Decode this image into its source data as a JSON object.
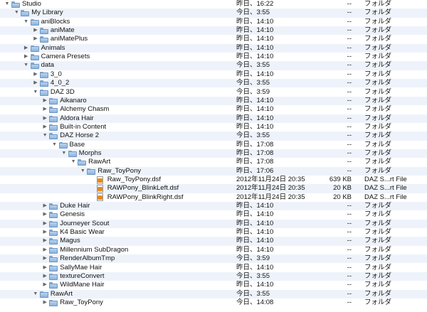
{
  "rows": [
    {
      "name": "Studio",
      "depth": 0,
      "expanded": true,
      "type": "folder",
      "date": "昨日、16:22",
      "size": "--",
      "kind": "フォルダ",
      "alt": false
    },
    {
      "name": "My Library",
      "depth": 1,
      "expanded": true,
      "type": "folder",
      "date": "今日、3:55",
      "size": "--",
      "kind": "フォルダ",
      "alt": true
    },
    {
      "name": "aniBlocks",
      "depth": 2,
      "expanded": true,
      "type": "folder",
      "date": "昨日、14:10",
      "size": "--",
      "kind": "フォルダ",
      "alt": false
    },
    {
      "name": "aniMate",
      "depth": 3,
      "expanded": false,
      "type": "folder",
      "date": "昨日、14:10",
      "size": "--",
      "kind": "フォルダ",
      "alt": true
    },
    {
      "name": "aniMatePlus",
      "depth": 3,
      "expanded": false,
      "type": "folder",
      "date": "昨日、14:10",
      "size": "--",
      "kind": "フォルダ",
      "alt": false
    },
    {
      "name": "Animals",
      "depth": 2,
      "expanded": false,
      "type": "folder",
      "date": "昨日、14:10",
      "size": "--",
      "kind": "フォルダ",
      "alt": true
    },
    {
      "name": "Camera Presets",
      "depth": 2,
      "expanded": false,
      "type": "folder",
      "date": "昨日、14:10",
      "size": "--",
      "kind": "フォルダ",
      "alt": false
    },
    {
      "name": "data",
      "depth": 2,
      "expanded": true,
      "type": "folder",
      "date": "今日、3:55",
      "size": "--",
      "kind": "フォルダ",
      "alt": true
    },
    {
      "name": "3_0",
      "depth": 3,
      "expanded": false,
      "type": "folder",
      "date": "昨日、14:10",
      "size": "--",
      "kind": "フォルダ",
      "alt": false
    },
    {
      "name": "4_0_2",
      "depth": 3,
      "expanded": false,
      "type": "folder",
      "date": "今日、3:55",
      "size": "--",
      "kind": "フォルダ",
      "alt": true
    },
    {
      "name": "DAZ 3D",
      "depth": 3,
      "expanded": true,
      "type": "folder",
      "date": "今日、3:59",
      "size": "--",
      "kind": "フォルダ",
      "alt": false
    },
    {
      "name": "Aikanaro",
      "depth": 4,
      "expanded": false,
      "type": "folder",
      "date": "昨日、14:10",
      "size": "--",
      "kind": "フォルダ",
      "alt": true
    },
    {
      "name": "Alchemy Chasm",
      "depth": 4,
      "expanded": false,
      "type": "folder",
      "date": "昨日、14:10",
      "size": "--",
      "kind": "フォルダ",
      "alt": false
    },
    {
      "name": "Aldora Hair",
      "depth": 4,
      "expanded": false,
      "type": "folder",
      "date": "昨日、14:10",
      "size": "--",
      "kind": "フォルダ",
      "alt": true
    },
    {
      "name": "Built-in Content",
      "depth": 4,
      "expanded": false,
      "type": "folder",
      "date": "昨日、14:10",
      "size": "--",
      "kind": "フォルダ",
      "alt": false
    },
    {
      "name": "DAZ Horse 2",
      "depth": 4,
      "expanded": true,
      "type": "folder",
      "date": "今日、3:55",
      "size": "--",
      "kind": "フォルダ",
      "alt": true
    },
    {
      "name": "Base",
      "depth": 5,
      "expanded": true,
      "type": "folder",
      "date": "昨日、17:08",
      "size": "--",
      "kind": "フォルダ",
      "alt": false
    },
    {
      "name": "Morphs",
      "depth": 6,
      "expanded": true,
      "type": "folder",
      "date": "昨日、17:08",
      "size": "--",
      "kind": "フォルダ",
      "alt": true
    },
    {
      "name": "RawArt",
      "depth": 7,
      "expanded": true,
      "type": "folder",
      "date": "昨日、17:08",
      "size": "--",
      "kind": "フォルダ",
      "alt": false
    },
    {
      "name": "Raw_ToyPony",
      "depth": 8,
      "expanded": true,
      "type": "folder",
      "date": "昨日、17:06",
      "size": "--",
      "kind": "フォルダ",
      "alt": true
    },
    {
      "name": "Raw_ToyPony.dsf",
      "depth": 9,
      "expanded": null,
      "type": "file",
      "date": "2012年11月24日 20:35",
      "size": "639 KB",
      "kind": "DAZ S...rt File",
      "alt": false
    },
    {
      "name": "RAWPony_BlinkLeft.dsf",
      "depth": 9,
      "expanded": null,
      "type": "file",
      "date": "2012年11月24日 20:35",
      "size": "20 KB",
      "kind": "DAZ S...rt File",
      "alt": true
    },
    {
      "name": "RAWPony_BlinkRight.dsf",
      "depth": 9,
      "expanded": null,
      "type": "file",
      "date": "2012年11月24日 20:35",
      "size": "20 KB",
      "kind": "DAZ S...rt File",
      "alt": false
    },
    {
      "name": "Duke Hair",
      "depth": 4,
      "expanded": false,
      "type": "folder",
      "date": "昨日、14:10",
      "size": "--",
      "kind": "フォルダ",
      "alt": true
    },
    {
      "name": "Genesis",
      "depth": 4,
      "expanded": false,
      "type": "folder",
      "date": "昨日、14:10",
      "size": "--",
      "kind": "フォルダ",
      "alt": false
    },
    {
      "name": "Journeyer Scout",
      "depth": 4,
      "expanded": false,
      "type": "folder",
      "date": "昨日、14:10",
      "size": "--",
      "kind": "フォルダ",
      "alt": true
    },
    {
      "name": "K4 Basic Wear",
      "depth": 4,
      "expanded": false,
      "type": "folder",
      "date": "昨日、14:10",
      "size": "--",
      "kind": "フォルダ",
      "alt": false
    },
    {
      "name": "Magus",
      "depth": 4,
      "expanded": false,
      "type": "folder",
      "date": "昨日、14:10",
      "size": "--",
      "kind": "フォルダ",
      "alt": true
    },
    {
      "name": "Millennium SubDragon",
      "depth": 4,
      "expanded": false,
      "type": "folder",
      "date": "昨日、14:10",
      "size": "--",
      "kind": "フォルダ",
      "alt": false
    },
    {
      "name": "RenderAlbumTmp",
      "depth": 4,
      "expanded": false,
      "type": "folder",
      "date": "今日、3:59",
      "size": "--",
      "kind": "フォルダ",
      "alt": true
    },
    {
      "name": "SallyMae Hair",
      "depth": 4,
      "expanded": false,
      "type": "folder",
      "date": "昨日、14:10",
      "size": "--",
      "kind": "フォルダ",
      "alt": false
    },
    {
      "name": "textureConvert",
      "depth": 4,
      "expanded": false,
      "type": "folder",
      "date": "今日、3:55",
      "size": "--",
      "kind": "フォルダ",
      "alt": true
    },
    {
      "name": "WildMane Hair",
      "depth": 4,
      "expanded": false,
      "type": "folder",
      "date": "昨日、14:10",
      "size": "--",
      "kind": "フォルダ",
      "alt": false
    },
    {
      "name": "RawArt",
      "depth": 3,
      "expanded": true,
      "type": "folder",
      "date": "今日、3:55",
      "size": "--",
      "kind": "フォルダ",
      "alt": true
    },
    {
      "name": "Raw_ToyPony",
      "depth": 4,
      "expanded": false,
      "type": "folder",
      "date": "今日、14:08",
      "size": "--",
      "kind": "フォルダ",
      "alt": false
    }
  ],
  "icons": {
    "folder": "folder-icon",
    "file": "dsf-file-icon",
    "expanded": "disclosure-expanded-icon",
    "collapsed": "disclosure-collapsed-icon"
  },
  "colors": {
    "alt_row": "#eef3fb",
    "folder": "#9dbfe3",
    "file_badge": "#e88a1a"
  }
}
